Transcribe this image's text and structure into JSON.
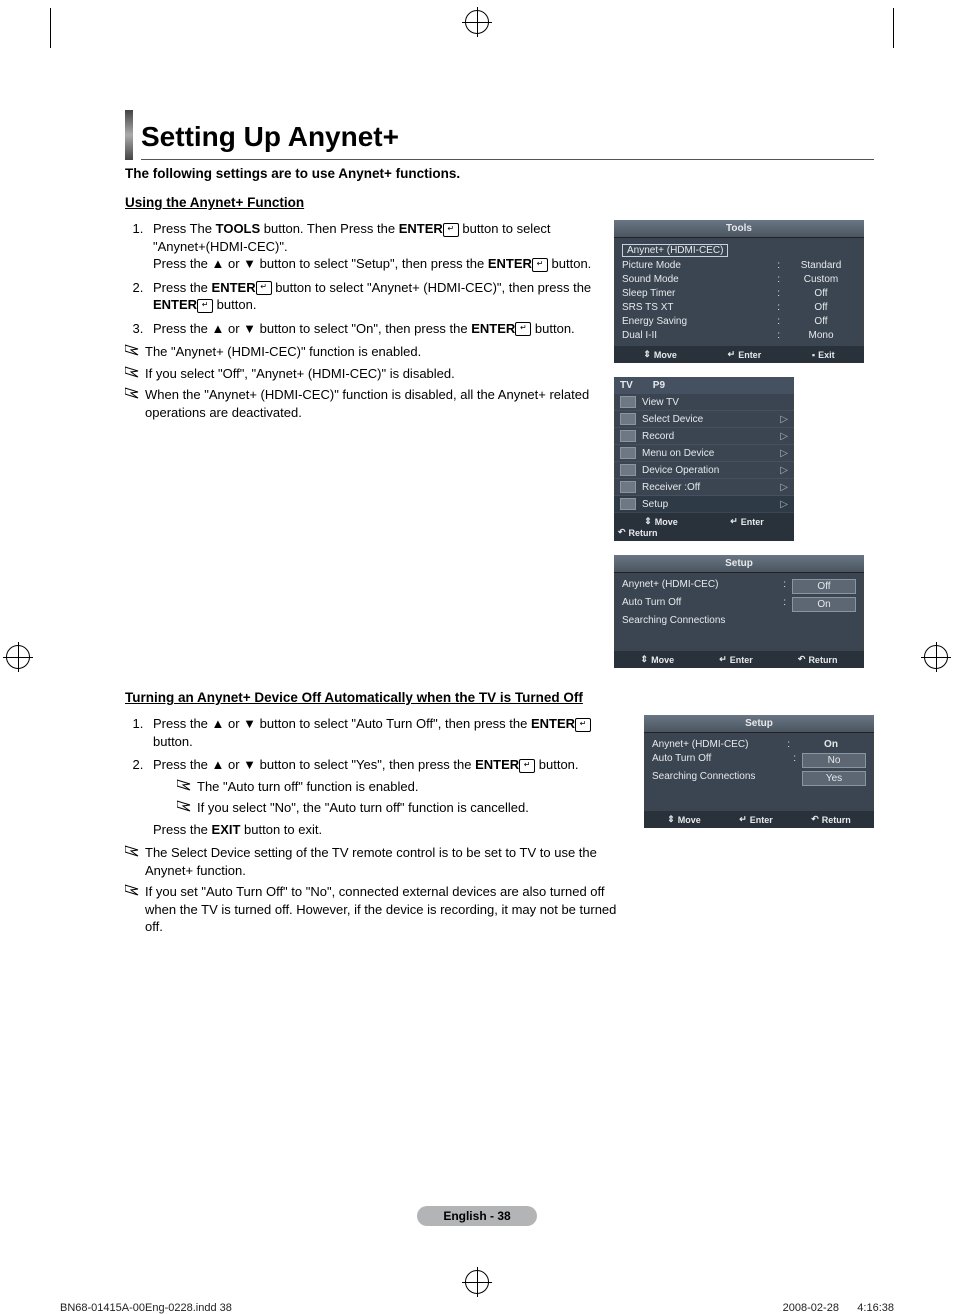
{
  "page": {
    "title": "Setting Up Anynet+",
    "subtitle": "The following settings are to use Anynet+ functions.",
    "page_label": "English - 38",
    "footer_left": "BN68-01415A-00Eng-0228.indd   38",
    "footer_right": "2008-02-28      4:16:38"
  },
  "section1": {
    "heading": "Using the Anynet+ Function",
    "step1a": "Press The ",
    "step1_tools": "TOOLS",
    "step1b": " button. Then Press the ",
    "step1_enter": "ENTER",
    "step1c": " button to select \"Anynet+(HDMI-CEC)\".",
    "step1d": "Press the ▲ or ▼ button to select \"Setup\", then press the ",
    "step1e": " button.",
    "step2a": "Press the ",
    "step2b": " button to select \"Anynet+ (HDMI-CEC)\", then press the ",
    "step2c": " button.",
    "step3a": "Press the ▲ or ▼ button to select \"On\", then press the ",
    "step3b": " button.",
    "note1": "The \"Anynet+ (HDMI-CEC)\" function is enabled.",
    "note2": "If you select \"Off\", \"Anynet+ (HDMI-CEC)\" is disabled.",
    "note3": "When the \"Anynet+ (HDMI-CEC)\" function is disabled, all the Anynet+ related operations are deactivated."
  },
  "section2": {
    "heading": "Turning an Anynet+ Device Off Automatically when the TV is Turned Off",
    "step1a": "Press the ▲ or ▼ button to select \"Auto Turn Off\", then press the ",
    "step1b": " button.",
    "step2a": "Press the ▲ or ▼ button to select \"Yes\", then press the ",
    "step2b": " button.",
    "sub_note1": "The \"Auto turn off\" function is enabled.",
    "sub_note2": "If you select \"No\", the \"Auto turn off\" function is cancelled.",
    "exit_line_a": "Press the ",
    "exit_bold": "EXIT",
    "exit_line_b": " button to exit.",
    "note1": "The Select Device setting of the TV remote control is to be set to TV to use the Anynet+ function.",
    "note2": "If you set \"Auto Turn Off\" to \"No\", connected external devices are also turned off when the TV is turned off. However, if the device is recording, it may not be turned off."
  },
  "tools_panel": {
    "title": "Tools",
    "selected": "Anynet+ (HDMI-CEC)",
    "rows": [
      {
        "label": "Picture Mode",
        "value": "Standard"
      },
      {
        "label": "Sound Mode",
        "value": "Custom"
      },
      {
        "label": "Sleep Timer",
        "value": "Off"
      },
      {
        "label": "SRS TS XT",
        "value": "Off"
      },
      {
        "label": "Energy Saving",
        "value": "Off"
      },
      {
        "label": "Dual I-II",
        "value": "Mono"
      }
    ],
    "footer": {
      "move": "Move",
      "enter": "Enter",
      "exit": "Exit"
    }
  },
  "tv_menu": {
    "tv": "TV",
    "chan": "P9",
    "items": [
      {
        "label": "View TV",
        "chev": false
      },
      {
        "label": "Select Device",
        "chev": true
      },
      {
        "label": "Record",
        "chev": true
      },
      {
        "label": "Menu on Device",
        "chev": true
      },
      {
        "label": "Device Operation",
        "chev": true
      },
      {
        "label": "Receiver    :Off",
        "chev": true
      },
      {
        "label": "Setup",
        "chev": true,
        "sel": true
      }
    ],
    "footer": {
      "move": "Move",
      "enter": "Enter",
      "return": "Return"
    }
  },
  "setup_panel1": {
    "title": "Setup",
    "rows": [
      {
        "label": "Anynet+ (HDMI-CEC)",
        "colon": ":",
        "value": "Off",
        "boxed": true
      },
      {
        "label": "Auto Turn Off",
        "colon": ":",
        "value": "On",
        "boxed": true
      },
      {
        "label": "Searching Connections",
        "colon": "",
        "value": "",
        "boxed": false
      }
    ],
    "footer": {
      "move": "Move",
      "enter": "Enter",
      "return": "Return"
    }
  },
  "setup_panel2": {
    "title": "Setup",
    "rows": [
      {
        "label": "Anynet+ (HDMI-CEC)",
        "colon": ":",
        "value": "On",
        "boxed": false
      },
      {
        "label": "Auto Turn Off",
        "colon": ":",
        "value": "No",
        "boxed": true
      },
      {
        "label": "Searching Connections",
        "colon": "",
        "value": "Yes",
        "boxed": true
      }
    ],
    "footer": {
      "move": "Move",
      "enter": "Enter",
      "return": "Return"
    }
  }
}
